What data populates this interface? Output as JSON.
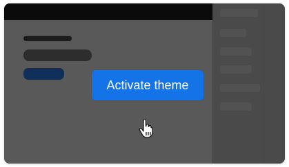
{
  "activate_button": {
    "label": "Activate theme",
    "color": "#1473e6"
  },
  "cursor": {
    "icon": "hand-pointer-icon"
  }
}
